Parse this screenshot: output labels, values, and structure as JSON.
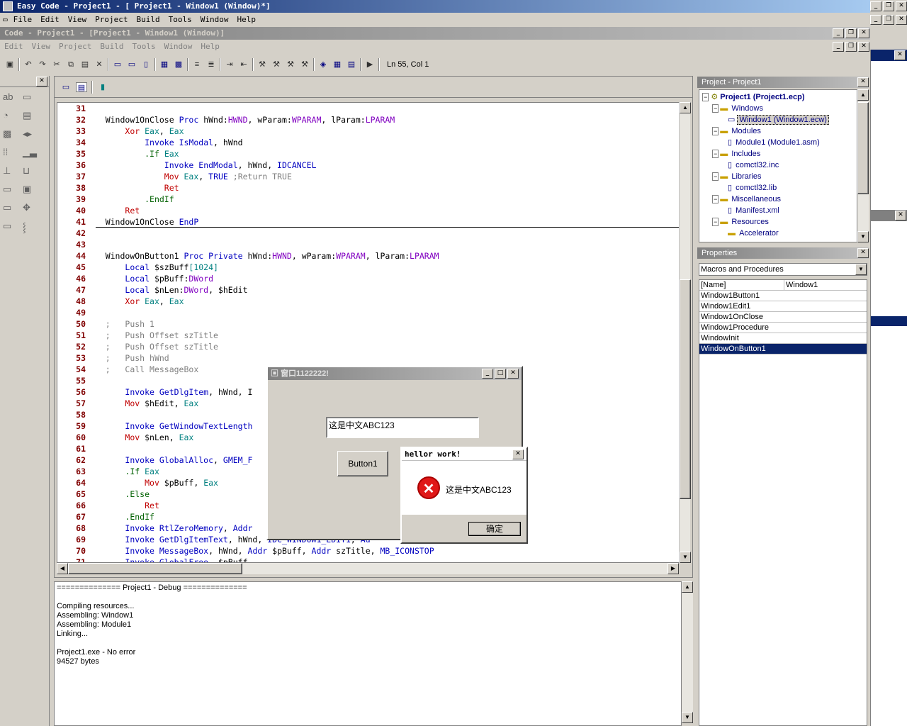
{
  "app": {
    "title": "Easy Code - Project1 - [ Project1 - Window1 (Window)*]"
  },
  "menu": [
    "File",
    "Edit",
    "View",
    "Project",
    "Build",
    "Tools",
    "Window",
    "Help"
  ],
  "child": {
    "title": "Code - Project1 - [Project1 - Window1 (Window)]",
    "menu": [
      "Edit",
      "View",
      "Project",
      "Build",
      "Tools",
      "Window",
      "Help"
    ]
  },
  "status": {
    "position": "Ln 55, Col 1"
  },
  "code_lines": [
    {
      "n": "31",
      "html": ""
    },
    {
      "n": "32",
      "html": "Window1OnClose <span class='k-blue'>Proc</span> hWnd:<span class='k-purple'>HWND</span>, wParam:<span class='k-purple'>WPARAM</span>, lParam:<span class='k-purple'>LPARAM</span>"
    },
    {
      "n": "33",
      "html": "    <span class='k-red'>Xor</span> <span class='k-teal'>Eax</span>, <span class='k-teal'>Eax</span>"
    },
    {
      "n": "34",
      "html": "        <span class='k-blue'>Invoke</span> <span class='k-blue'>IsModal</span>, hWnd"
    },
    {
      "n": "35",
      "html": "        <span class='k-green'>.If</span> <span class='k-teal'>Eax</span>"
    },
    {
      "n": "36",
      "html": "            <span class='k-blue'>Invoke</span> <span class='k-blue'>EndModal</span>, hWnd, <span class='k-blue'>IDCANCEL</span>"
    },
    {
      "n": "37",
      "html": "            <span class='k-red'>Mov</span> <span class='k-teal'>Eax</span>, <span class='k-blue'>TRUE</span> <span class='k-cmt'>;Return TRUE</span>"
    },
    {
      "n": "38",
      "html": "            <span class='k-red'>Ret</span>"
    },
    {
      "n": "39",
      "html": "        <span class='k-green'>.EndIf</span>"
    },
    {
      "n": "40",
      "html": "    <span class='k-red'>Ret</span>"
    },
    {
      "n": "41",
      "html": "Window1OnClose <span class='k-blue'>EndP</span>"
    },
    {
      "n": "42",
      "html": ""
    },
    {
      "n": "43",
      "html": ""
    },
    {
      "n": "44",
      "html": "WindowOnButton1 <span class='k-blue'>Proc</span> <span class='k-blue'>Private</span> hWnd:<span class='k-purple'>HWND</span>, wParam:<span class='k-purple'>WPARAM</span>, lParam:<span class='k-purple'>LPARAM</span>"
    },
    {
      "n": "45",
      "html": "    <span class='k-blue'>Local</span> $szBuff<span class='k-teal'>[1024]</span>"
    },
    {
      "n": "46",
      "html": "    <span class='k-blue'>Local</span> $pBuff:<span class='k-purple'>DWord</span>"
    },
    {
      "n": "47",
      "html": "    <span class='k-blue'>Local</span> $nLen:<span class='k-purple'>DWord</span>, $hEdit"
    },
    {
      "n": "48",
      "html": "    <span class='k-red'>Xor</span> <span class='k-teal'>Eax</span>, <span class='k-teal'>Eax</span>"
    },
    {
      "n": "49",
      "html": ""
    },
    {
      "n": "50",
      "html": "<span class='k-cmt'>;   Push 1</span>"
    },
    {
      "n": "51",
      "html": "<span class='k-cmt'>;   Push Offset szTitle</span>"
    },
    {
      "n": "52",
      "html": "<span class='k-cmt'>;   Push Offset szTitle</span>"
    },
    {
      "n": "53",
      "html": "<span class='k-cmt'>;   Push hWnd</span>"
    },
    {
      "n": "54",
      "html": "<span class='k-cmt'>;   Call MessageBox</span>"
    },
    {
      "n": "55",
      "html": ""
    },
    {
      "n": "56",
      "html": "    <span class='k-blue'>Invoke</span> <span class='k-blue'>GetDlgItem</span>, hWnd, I"
    },
    {
      "n": "57",
      "html": "    <span class='k-red'>Mov</span> $hEdit, <span class='k-teal'>Eax</span>"
    },
    {
      "n": "58",
      "html": ""
    },
    {
      "n": "59",
      "html": "    <span class='k-blue'>Invoke</span> <span class='k-blue'>GetWindowTextLength</span>"
    },
    {
      "n": "60",
      "html": "    <span class='k-red'>Mov</span> $nLen, <span class='k-teal'>Eax</span>"
    },
    {
      "n": "61",
      "html": ""
    },
    {
      "n": "62",
      "html": "    <span class='k-blue'>Invoke</span> <span class='k-blue'>GlobalAlloc</span>, <span class='k-blue'>GMEM_F</span>"
    },
    {
      "n": "63",
      "html": "    <span class='k-green'>.If</span> <span class='k-teal'>Eax</span>"
    },
    {
      "n": "64",
      "html": "        <span class='k-red'>Mov</span> $pBuff, <span class='k-teal'>Eax</span>"
    },
    {
      "n": "65",
      "html": "    <span class='k-green'>.Else</span>"
    },
    {
      "n": "66",
      "html": "        <span class='k-red'>Ret</span>"
    },
    {
      "n": "67",
      "html": "    <span class='k-green'>.EndIf</span>"
    },
    {
      "n": "68",
      "html": "    <span class='k-blue'>Invoke</span> <span class='k-blue'>RtlZeroMemory</span>, <span class='k-blue'>Addr</span>"
    },
    {
      "n": "69",
      "html": "    <span class='k-blue'>Invoke</span> <span class='k-blue'>GetDlgItemText</span>, hWnd, <span class='k-blue'>IDC_WINDOW1_EDIT1</span>, <span class='k-blue'>Ad</span>"
    },
    {
      "n": "70",
      "html": "    <span class='k-blue'>Invoke</span> <span class='k-blue'>MessageBox</span>, hWnd, <span class='k-blue'>Addr</span> $pBuff, <span class='k-blue'>Addr</span> szTitle, <span class='k-blue'>MB_ICONSTOP</span>"
    },
    {
      "n": "71",
      "html": "    <span class='k-blue'>Invoke</span> <span class='k-blue'>GlobalFree</span>, $pBuff"
    }
  ],
  "output": {
    "header": "============== Project1 - Debug ==============",
    "lines": [
      "",
      "Compiling resources...",
      "Assembling: Window1",
      "Assembling: Module1",
      "Linking...",
      "",
      "Project1.exe - No error",
      "94527 bytes"
    ]
  },
  "project": {
    "title": "Project - Project1",
    "root": "Project1 (Project1.ecp)",
    "items": [
      {
        "label": "Windows",
        "level": 1,
        "type": "folder"
      },
      {
        "label": "Window1 (Window1.ecw)",
        "level": 2,
        "type": "window",
        "selected": true
      },
      {
        "label": "Modules",
        "level": 1,
        "type": "folder"
      },
      {
        "label": "Module1 (Module1.asm)",
        "level": 2,
        "type": "file"
      },
      {
        "label": "Includes",
        "level": 1,
        "type": "folder"
      },
      {
        "label": "comctl32.inc",
        "level": 2,
        "type": "file"
      },
      {
        "label": "Libraries",
        "level": 1,
        "type": "folder"
      },
      {
        "label": "comctl32.lib",
        "level": 2,
        "type": "file"
      },
      {
        "label": "Miscellaneous",
        "level": 1,
        "type": "folder"
      },
      {
        "label": "Manifest.xml",
        "level": 2,
        "type": "file"
      },
      {
        "label": "Resources",
        "level": 1,
        "type": "folder"
      },
      {
        "label": "Accelerator",
        "level": 2,
        "type": "folder"
      }
    ]
  },
  "properties": {
    "title": "Properties",
    "dropdown": "Macros and Procedures",
    "col1": "[Name]",
    "col2": "Window1",
    "rows": [
      "Window1Button1",
      "Window1Edit1",
      "Window1OnClose",
      "Window1Procedure",
      "WindowInit",
      "WindowOnButton1"
    ],
    "selected": "WindowOnButton1"
  },
  "dialog": {
    "title": "窗口1122222!",
    "edit_value": "这是中文ABC123",
    "button": "Button1"
  },
  "msgbox": {
    "title": "hellor work!",
    "text": "这是中文ABC123",
    "ok": "确定"
  }
}
